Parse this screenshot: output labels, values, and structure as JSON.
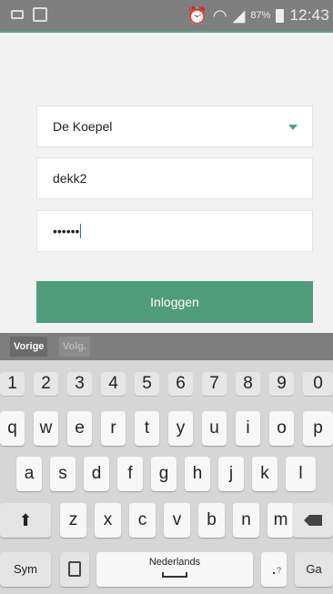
{
  "status_bar": {
    "battery_percent": "87%",
    "time": "12:43",
    "icons": [
      "voicemail-icon",
      "image-icon",
      "alarm-icon",
      "wifi-icon",
      "signal-icon",
      "battery-icon"
    ]
  },
  "login_form": {
    "location_select": {
      "value": "De Koepel"
    },
    "username": {
      "value": "dekk2"
    },
    "password": {
      "value": "••••••"
    },
    "login_button": {
      "label": "Inloggen"
    },
    "accent_color": "#4f9c7c"
  },
  "keyboard_toolbar": {
    "prev_label": "Vorige",
    "next_label": "Volg."
  },
  "keyboard": {
    "number_row": [
      "1",
      "2",
      "3",
      "4",
      "5",
      "6",
      "7",
      "8",
      "9",
      "0"
    ],
    "row1": [
      "q",
      "w",
      "e",
      "r",
      "t",
      "y",
      "u",
      "i",
      "o",
      "p"
    ],
    "row2": [
      "a",
      "s",
      "d",
      "f",
      "g",
      "h",
      "j",
      "k",
      "l"
    ],
    "row3": [
      "z",
      "x",
      "c",
      "v",
      "b",
      "n",
      "m"
    ],
    "sym_label": "Sym",
    "space_label": "Nederlands",
    "go_label": "Ga",
    "punct_label": ".",
    "punct_hint": "?"
  }
}
